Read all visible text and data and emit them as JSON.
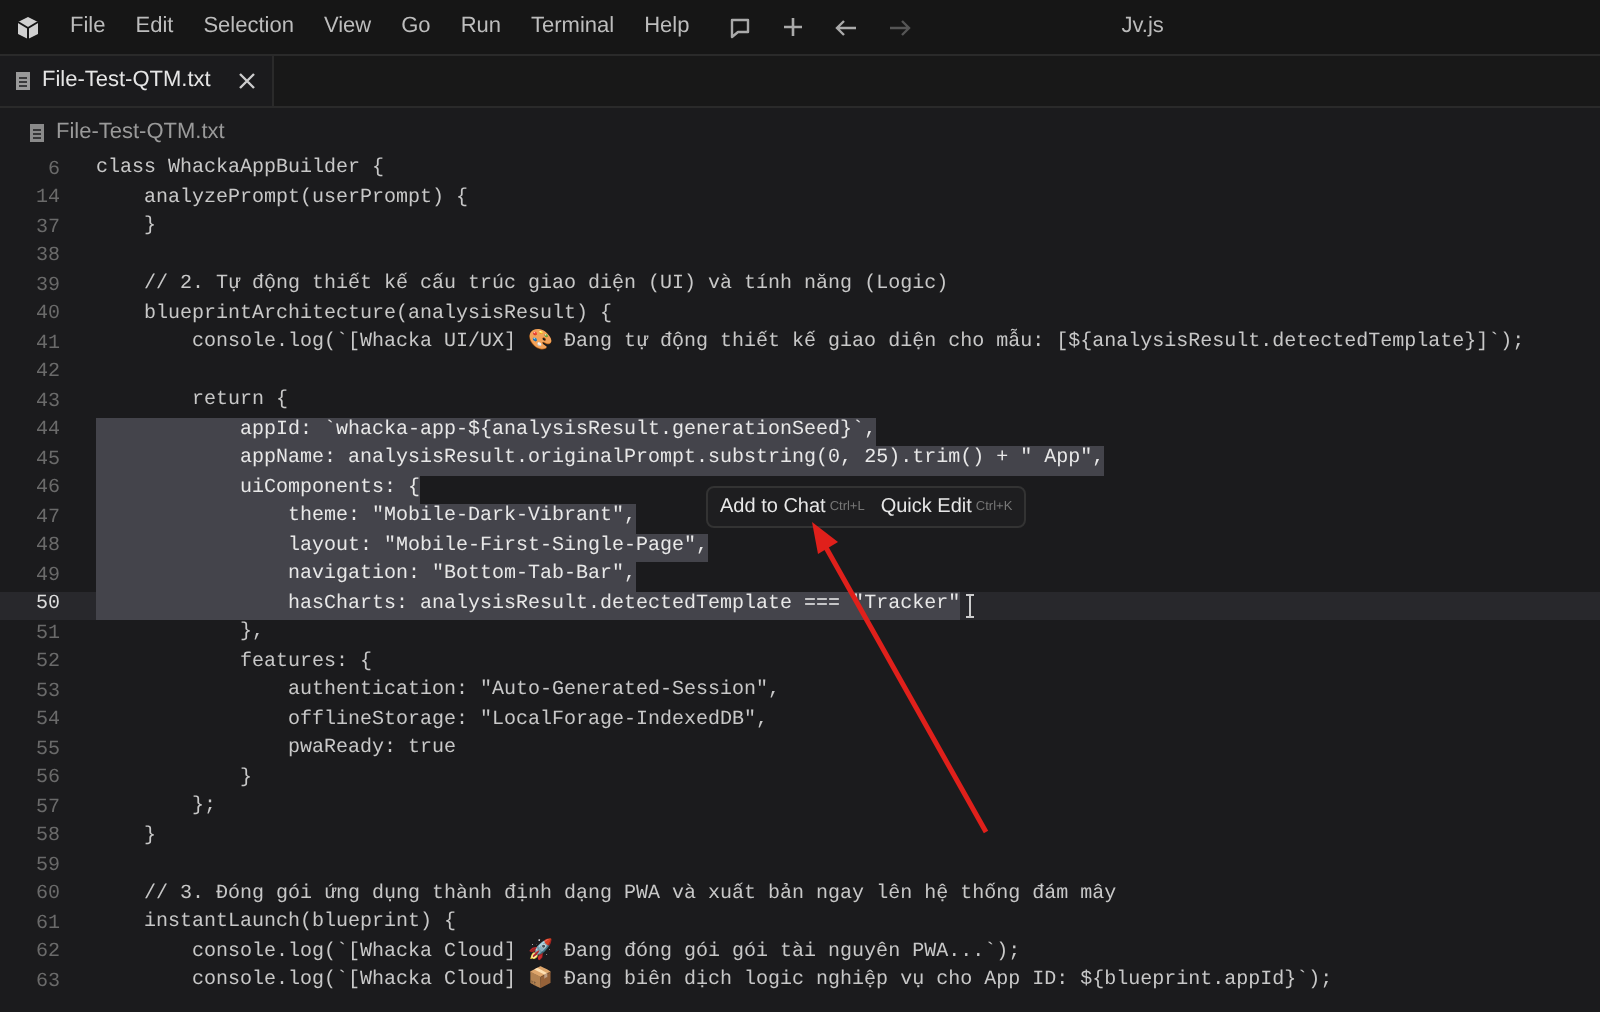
{
  "menu": [
    "File",
    "Edit",
    "Selection",
    "View",
    "Go",
    "Run",
    "Terminal",
    "Help"
  ],
  "window": {
    "title": "Jv.js"
  },
  "tabs": [
    {
      "label": "File-Test-QTM.txt",
      "selected": true
    }
  ],
  "breadcrumb": "File-Test-QTM.txt",
  "lines": [
    {
      "number": "6",
      "text": "class WhackaAppBuilder {",
      "selected": false
    },
    {
      "number": "14",
      "text": "    analyzePrompt(userPrompt) {",
      "selected": false
    },
    {
      "number": "37",
      "text": "    }",
      "selected": false
    },
    {
      "number": "38"
    },
    {
      "number": "39",
      "text": "    // 2. Tự động thiết kế cấu trúc giao diện (UI) và tính năng (Logic)",
      "selected": false
    },
    {
      "number": "40",
      "text": "    blueprintArchitecture(analysisResult) {",
      "selected": false
    },
    {
      "number": "41",
      "text": "        console.log(`[Whacka UI/UX] 🎨 Đang tự động thiết kế giao diện cho mẫu: [${analysisResult.detectedTemplate}]`);",
      "selected": false
    },
    {
      "number": "42"
    },
    {
      "number": "43",
      "text": "        return {",
      "selected": false
    },
    {
      "number": "44",
      "text": "            appId: `whacka-app-${analysisResult.generationSeed}`,",
      "selected": true
    },
    {
      "number": "45",
      "text": "            appName: analysisResult.originalPrompt.substring(0, 25).trim() + \" App\",",
      "selected": true
    },
    {
      "number": "46",
      "text": "            uiComponents: {",
      "selected": true
    },
    {
      "number": "47",
      "text": "                theme: \"Mobile-Dark-Vibrant\",",
      "selected": true
    },
    {
      "number": "48",
      "text": "                layout: \"Mobile-First-Single-Page\",",
      "selected": true
    },
    {
      "number": "49",
      "text": "                navigation: \"Bottom-Tab-Bar\",",
      "selected": true
    },
    {
      "number": "50",
      "text": "                hasCharts: analysisResult.detectedTemplate === \"Tracker\"",
      "selected": true,
      "current": true
    },
    {
      "number": "51",
      "text": "            },",
      "selected": false
    },
    {
      "number": "52",
      "text": "            features: {",
      "selected": false
    },
    {
      "number": "53",
      "text": "                authentication: \"Auto-Generated-Session\",",
      "selected": false
    },
    {
      "number": "54",
      "text": "                offlineStorage: \"LocalForage-IndexedDB\",",
      "selected": false
    },
    {
      "number": "55",
      "text": "                pwaReady: true",
      "selected": false
    },
    {
      "number": "56",
      "text": "            }",
      "selected": false
    },
    {
      "number": "57",
      "text": "        };",
      "selected": false
    },
    {
      "number": "58",
      "text": "    }",
      "selected": false
    },
    {
      "number": "59"
    },
    {
      "number": "60",
      "text": "    // 3. Đóng gói ứng dụng thành định dạng PWA và xuất bản ngay lên hệ thống đám mây",
      "selected": false
    },
    {
      "number": "61",
      "text": "    instantLaunch(blueprint) {",
      "selected": false
    },
    {
      "number": "62",
      "text": "        console.log(`[Whacka Cloud] 🚀 Đang đóng gói gói tài nguyên PWA...`);",
      "selected": false
    },
    {
      "number": "63",
      "text": "        console.log(`[Whacka Cloud] 📦 Đang biên dịch logic nghiệp vụ cho App ID: ${blueprint.appId}`);",
      "selected": false
    }
  ],
  "popup": [
    {
      "label": "Add to Chat",
      "shortcut": "Ctrl+L"
    },
    {
      "label": "Quick Edit",
      "shortcut": "Ctrl+K"
    }
  ]
}
